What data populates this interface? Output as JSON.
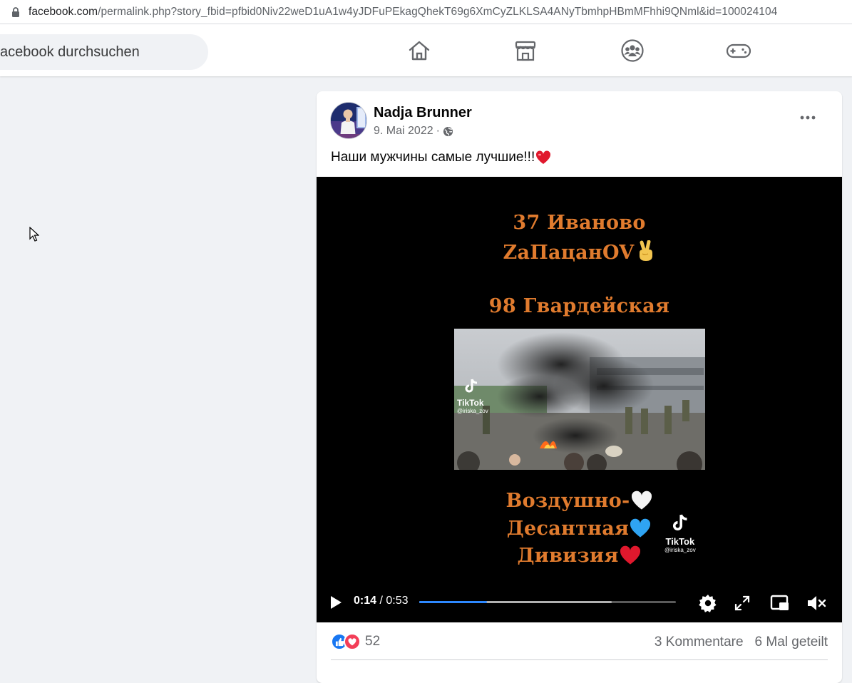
{
  "browser": {
    "url_host": "facebook.com",
    "url_path": "/permalink.php?story_fbid=pfbid0Niv22weD1uA1w4yJDFuPEkagQhekT69g6XmCyZLKLSA4ANyTbmhpHBmMFhhi9QNml&id=100024104"
  },
  "search": {
    "placeholder": "acebook durchsuchen"
  },
  "nav": {
    "icons": [
      "home-icon",
      "marketplace-icon",
      "groups-icon",
      "gaming-icon"
    ]
  },
  "post": {
    "author": "Nadja Brunner",
    "date": "9. Mai 2022",
    "separator": "·",
    "audience_icon": "globe-icon",
    "caption": "Наши мужчины самые лучшие!!!",
    "caption_emoji": "heart",
    "video": {
      "line1": "37 Иваново",
      "line2": "ZаПацанOV",
      "line3": "98  Гвардейская",
      "line4": "Воздушно-",
      "line5": "Десантная",
      "line6": "Дивизия",
      "tiktok_label": "TikTok",
      "tiktok_handle": "@iriska_zov",
      "time_current": "0:14",
      "time_separator": " / ",
      "time_total": "0:53",
      "progress_played": 0.2642,
      "progress_buffered": 0.75,
      "colors": {
        "text": "#e07b2e",
        "progress": "#2d88ff"
      }
    },
    "reactions": {
      "types": [
        "like",
        "love"
      ],
      "count": "52"
    },
    "comments": "3 Kommentare",
    "shares": "6 Mal geteilt"
  }
}
